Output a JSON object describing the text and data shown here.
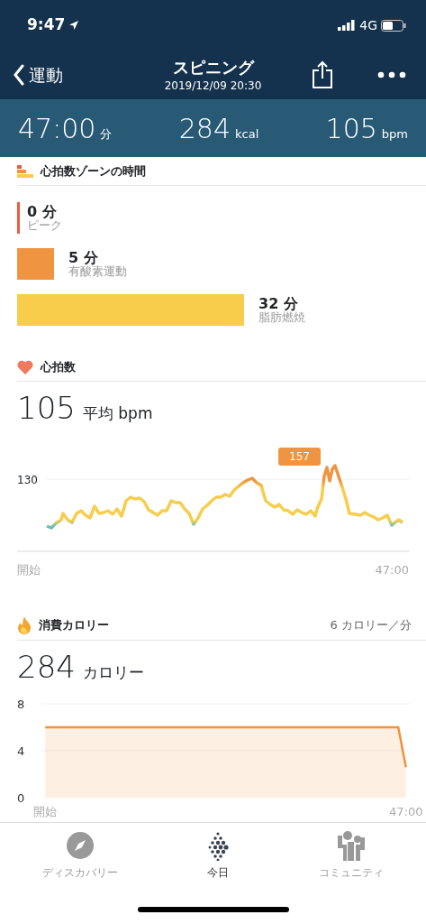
{
  "status_bar": {
    "time": "9:47",
    "network": "4G"
  },
  "nav": {
    "back_label": "運動",
    "title": "スピニング",
    "subtitle": "2019/12/09 20:30"
  },
  "stats": [
    {
      "value": "47:00",
      "unit": "分"
    },
    {
      "value": "284",
      "unit": "kcal"
    },
    {
      "value": "105",
      "unit": "bpm"
    }
  ],
  "zones": {
    "title": "心拍数ゾーンの時間",
    "items": [
      {
        "minutes": "0 分",
        "label": "ピーク",
        "color": "#ee5a3a"
      },
      {
        "minutes": "5 分",
        "label": "有酸素運動",
        "color": "#ef9440"
      },
      {
        "minutes": "32 分",
        "label": "脂肪燃焼",
        "color": "#f7cd4b"
      }
    ]
  },
  "heart_rate": {
    "title": "心拍数",
    "value": "105",
    "unit": "平均 bpm",
    "tick": "130",
    "peak_label": "157",
    "x_start": "開始",
    "x_end": "47:00"
  },
  "calories": {
    "title": "消費カロリー",
    "rate": "6 カロリー／分",
    "value": "284",
    "unit": "カロリー",
    "chart_data": {
      "type": "area",
      "categories": [
        "開始",
        null,
        null,
        null,
        null,
        null,
        null,
        null,
        null,
        null,
        null,
        null,
        null,
        null,
        null,
        null,
        null,
        null,
        null,
        null,
        null,
        null,
        null,
        null,
        null,
        null,
        null,
        null,
        null,
        null,
        null,
        null,
        null,
        null,
        null,
        null,
        null,
        null,
        null,
        null,
        null,
        null,
        null,
        null,
        null,
        null,
        null,
        "47:00"
      ],
      "series": [
        {
          "color": "#f0923a",
          "values": [
            6,
            6,
            6,
            6,
            6,
            6,
            6,
            6,
            6,
            6,
            6,
            6,
            6,
            6,
            6,
            6,
            6,
            6,
            6,
            6,
            6,
            6,
            6,
            6,
            6,
            6,
            6,
            6,
            6,
            6,
            6,
            6,
            6,
            6,
            6,
            6,
            6,
            6,
            6,
            6,
            6,
            6,
            6,
            6,
            6,
            6,
            6,
            2.6
          ]
        }
      ],
      "ylim": [
        0,
        8
      ],
      "yticks": [
        0,
        4,
        8
      ]
    }
  },
  "tabs": [
    {
      "label": "ディスカバリー",
      "selected": false,
      "kind": "compass"
    },
    {
      "label": "今日",
      "selected": true,
      "kind": "dots"
    },
    {
      "label": "コミュニティ",
      "selected": false,
      "kind": "people"
    }
  ]
}
